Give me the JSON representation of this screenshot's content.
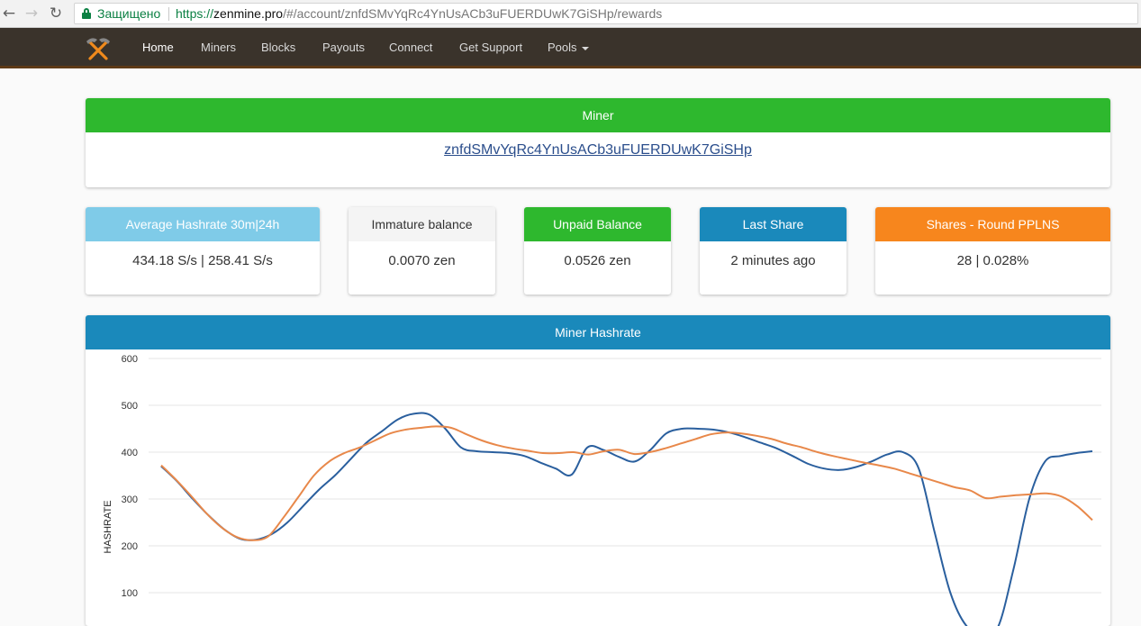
{
  "browser": {
    "back_icon": "arrow-left-icon",
    "forward_icon": "arrow-right-icon",
    "reload_icon": "reload-icon",
    "secure_label": "Защищено",
    "url_scheme": "https://",
    "url_host": "zenmine.pro",
    "url_path": "/#/account/znfdSMvYqRc4YnUsACb3uFUERDUwK7GiSHp/rewards"
  },
  "navbar": {
    "items": [
      {
        "label": "Home"
      },
      {
        "label": "Miners"
      },
      {
        "label": "Blocks"
      },
      {
        "label": "Payouts"
      },
      {
        "label": "Connect"
      },
      {
        "label": "Get Support"
      },
      {
        "label": "Pools"
      }
    ],
    "active": "Home"
  },
  "miner": {
    "title": "Miner",
    "address": "znfdSMvYqRc4YnUsACb3uFUERDUwK7GiSHp"
  },
  "stats": [
    {
      "title": "Average Hashrate 30m|24h",
      "value": "434.18 S/s | 258.41 S/s"
    },
    {
      "title": "Immature balance",
      "value": "0.0070 zen"
    },
    {
      "title": "Unpaid Balance",
      "value": "0.0526 zen"
    },
    {
      "title": "Last Share",
      "value": "2 minutes ago"
    },
    {
      "title": "Shares - Round PPLNS",
      "value": "28 | 0.028%"
    }
  ],
  "chart": {
    "title": "Miner Hashrate"
  },
  "colors": {
    "green": "#2eb82e",
    "light_blue": "#7fcbe8",
    "blue": "#1a89bb",
    "orange": "#f7861d",
    "nav_bg": "#3a332b",
    "series_current": "#2a5f9e",
    "series_average": "#e8884a"
  },
  "chart_data": {
    "type": "line",
    "title": "",
    "xlabel": "",
    "ylabel": "HASHRATE",
    "ylim": [
      0,
      600
    ],
    "yticks": [
      100,
      200,
      300,
      400,
      500,
      600
    ],
    "grid": true,
    "series": [
      {
        "values": [
          370,
          338,
          300,
          265,
          235,
          215,
          213,
          225,
          250,
          285,
          320,
          350,
          385,
          420,
          445,
          470,
          482,
          480,
          450,
          410,
          402,
          400,
          398,
          392,
          378,
          365,
          352,
          410,
          405,
          390,
          380,
          405,
          440,
          450,
          450,
          448,
          442,
          432,
          420,
          408,
          392,
          375,
          365,
          362,
          368,
          380,
          395,
          400,
          365,
          230,
          100,
          30,
          15,
          25,
          150,
          300,
          380,
          392,
          398,
          402
        ]
      },
      {
        "values": [
          372,
          340,
          305,
          268,
          238,
          218,
          212,
          220,
          260,
          305,
          350,
          380,
          398,
          410,
          425,
          440,
          448,
          452,
          455,
          452,
          438,
          425,
          415,
          408,
          403,
          398,
          398,
          400,
          395,
          402,
          405,
          396,
          400,
          408,
          418,
          428,
          438,
          442,
          440,
          435,
          428,
          418,
          410,
          400,
          392,
          385,
          378,
          372,
          365,
          355,
          345,
          335,
          325,
          318,
          302,
          305,
          308,
          310,
          312,
          305,
          285,
          255
        ]
      }
    ]
  }
}
